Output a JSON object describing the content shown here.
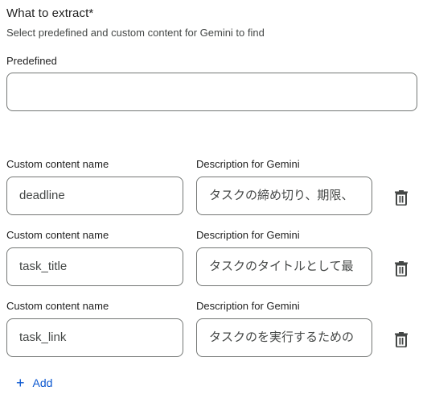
{
  "section": {
    "title": "What to extract*",
    "subtitle": "Select predefined and custom content for Gemini to find"
  },
  "predefined": {
    "label": "Predefined",
    "value": ""
  },
  "custom_rows": [
    {
      "name_label": "Custom content name",
      "desc_label": "Description for Gemini",
      "name_value": "deadline",
      "desc_value": "タスクの締め切り、期限、"
    },
    {
      "name_label": "Custom content name",
      "desc_label": "Description for Gemini",
      "name_value": "task_title",
      "desc_value": "タスクのタイトルとして最"
    },
    {
      "name_label": "Custom content name",
      "desc_label": "Description for Gemini",
      "name_value": "task_link",
      "desc_value": "タスクのを実行するための"
    }
  ],
  "actions": {
    "add_icon": "+",
    "add_label": "Add",
    "delete_icon": "trash-icon"
  },
  "colors": {
    "accent": "#0b57d0",
    "border": "#747775",
    "text": "#1f1f1f",
    "muted": "#444746"
  }
}
